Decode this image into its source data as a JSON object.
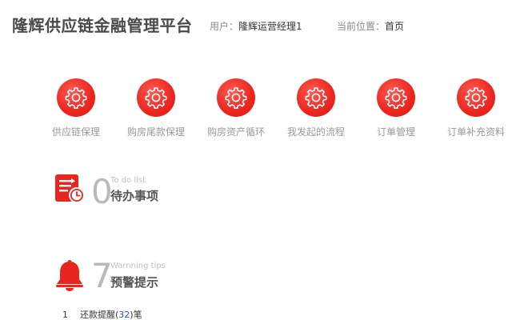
{
  "header": {
    "title": "隆辉供应链金融管理平台",
    "user_label": "用户：",
    "user_name": "隆辉运营经理1",
    "location_label": "当前位置：",
    "location_value": "首页"
  },
  "quick_nav": [
    {
      "label": "供应链保理",
      "icon": "gear-icon"
    },
    {
      "label": "购房尾款保理",
      "icon": "gear-icon"
    },
    {
      "label": "购房资产循环",
      "icon": "gear-icon"
    },
    {
      "label": "我发起的流程",
      "icon": "gear-icon"
    },
    {
      "label": "订单管理",
      "icon": "gear-icon"
    },
    {
      "label": "订单补充资料",
      "icon": "gear-icon"
    }
  ],
  "todo": {
    "count": "0",
    "en": "To do list",
    "cn": "待办事项",
    "icon": "todo-clock-icon"
  },
  "warning": {
    "count": "7",
    "en": "Warnning tips",
    "cn": "预警提示",
    "icon": "bell-icon"
  },
  "warning_items": [
    {
      "index": "1",
      "text": "还款提醒(",
      "count": "32",
      "suffix": ")笔"
    }
  ],
  "colors": {
    "accent": "#e8251e",
    "link": "#2b4fd6"
  }
}
